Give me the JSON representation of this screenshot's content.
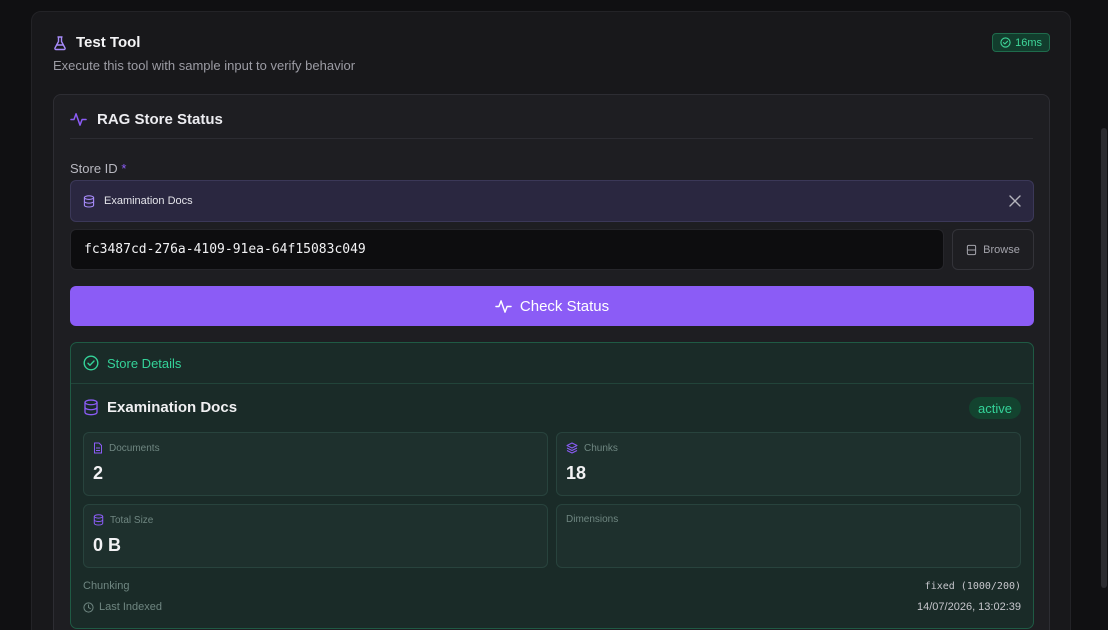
{
  "panel": {
    "title": "Test Tool",
    "subtitle": "Execute this tool with sample input to verify behavior",
    "timing": "16ms"
  },
  "card": {
    "title": "RAG Store Status",
    "field_label": "Store ID",
    "required_mark": "*",
    "selected_store": "Examination Docs",
    "store_id_value": "fc3487cd-276a-4109-91ea-64f15083c049",
    "browse_label": "Browse",
    "check_label": "Check Status"
  },
  "details": {
    "title": "Store Details",
    "store_name": "Examination Docs",
    "status": "active",
    "stats": {
      "documents_label": "Documents",
      "documents_value": "2",
      "chunks_label": "Chunks",
      "chunks_value": "18",
      "size_label": "Total Size",
      "size_value": "0 B",
      "dimensions_label": "Dimensions",
      "dimensions_value": ""
    },
    "chunking_label": "Chunking",
    "chunking_value": "fixed (1000/200)",
    "last_indexed_label": "Last Indexed",
    "last_indexed_value": "14/07/2026, 13:02:39"
  },
  "colors": {
    "accent": "#8b5cf6",
    "success": "#34d399",
    "background": "#101012"
  }
}
